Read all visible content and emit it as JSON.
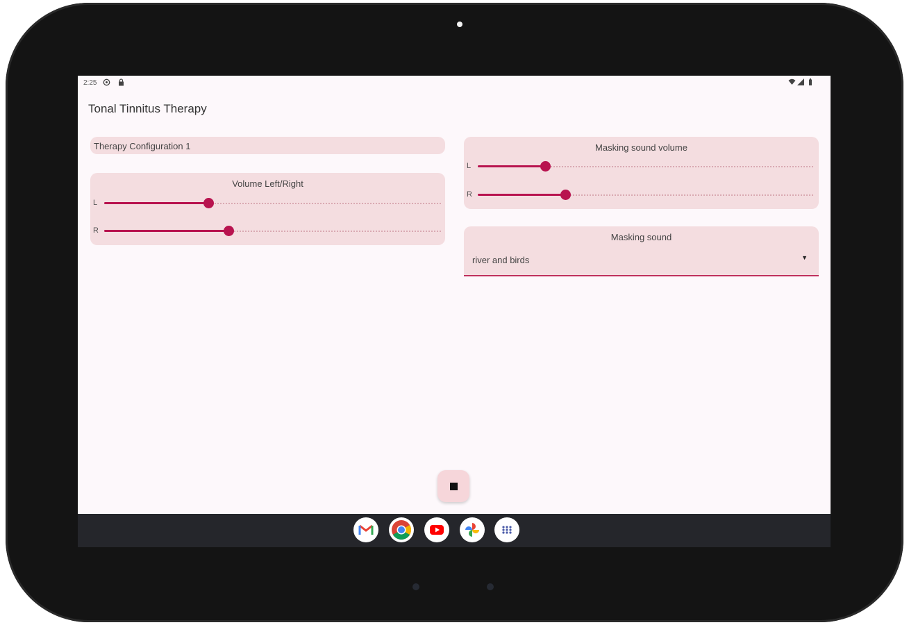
{
  "status_bar": {
    "time": "2:25",
    "left_icons": [
      "settings-status-icon",
      "lock-status-icon"
    ],
    "right_icons": [
      "wifi-icon",
      "signal-icon",
      "battery-icon"
    ]
  },
  "app": {
    "title": "Tonal Tinnitus Therapy"
  },
  "config": {
    "name": "Therapy Configuration 1"
  },
  "volume_lr": {
    "title": "Volume Left/Right",
    "left": {
      "label": "L",
      "value": 0.31
    },
    "right": {
      "label": "R",
      "value": 0.37
    }
  },
  "masking_volume": {
    "title": "Masking sound volume",
    "left": {
      "label": "L",
      "value": 0.2
    },
    "right": {
      "label": "R",
      "value": 0.26
    }
  },
  "masking_sound": {
    "title": "Masking sound",
    "selected": "river and birds"
  },
  "fab": {
    "icon": "stop-icon"
  },
  "dock": {
    "apps": [
      "gmail-icon",
      "chrome-icon",
      "youtube-icon",
      "photos-icon",
      "app-drawer-icon"
    ]
  },
  "colors": {
    "accent": "#b8134f",
    "card_background": "#f4dde0",
    "screen_background": "#fdf8fb",
    "taskbar": "#25262b"
  }
}
